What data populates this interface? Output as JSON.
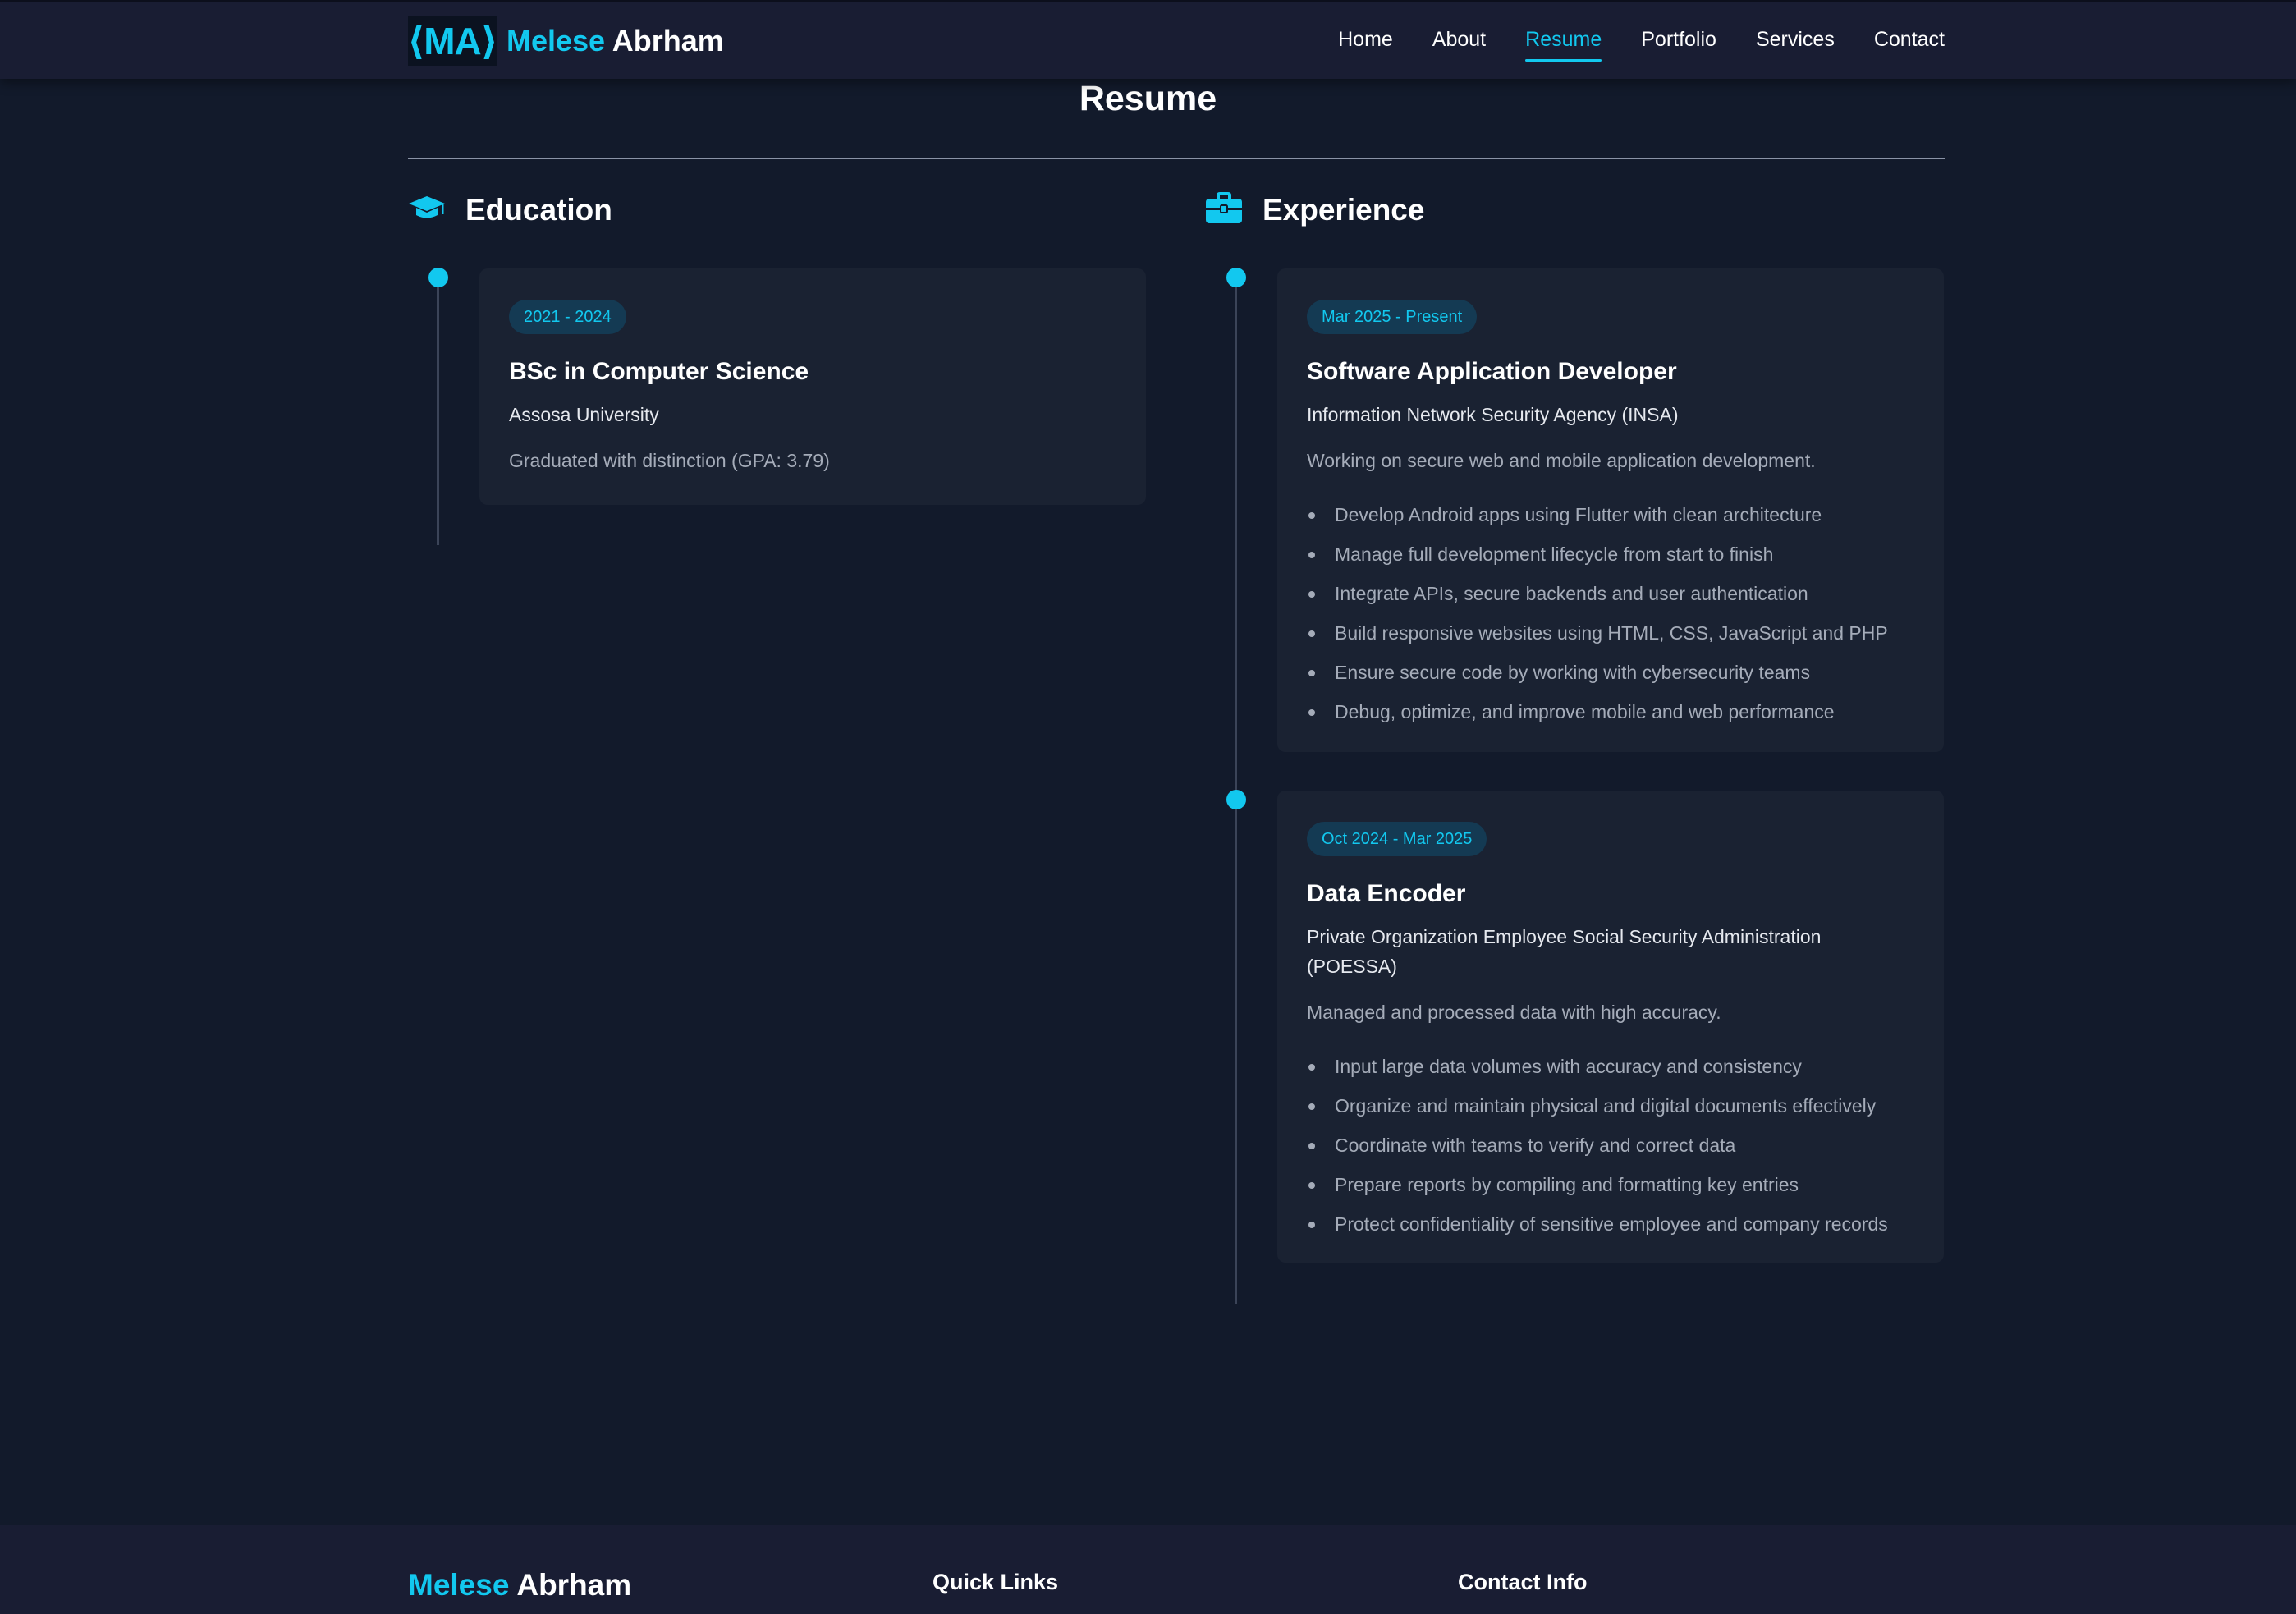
{
  "header": {
    "logo_badge": "⟨MA⟩",
    "brand_first": "Melese",
    "brand_last": "Abrham",
    "nav": [
      {
        "label": "Home",
        "active": false
      },
      {
        "label": "About",
        "active": false
      },
      {
        "label": "Resume",
        "active": true
      },
      {
        "label": "Portfolio",
        "active": false
      },
      {
        "label": "Services",
        "active": false
      },
      {
        "label": "Contact",
        "active": false
      }
    ]
  },
  "resume": {
    "title": "Resume",
    "education": {
      "heading": "Education",
      "icon": "graduation-cap-icon",
      "items": [
        {
          "date": "2021 - 2024",
          "title": "BSc in Computer Science",
          "organization": "Assosa University",
          "description": "Graduated with distinction (GPA: 3.79)"
        }
      ]
    },
    "experience": {
      "heading": "Experience",
      "icon": "briefcase-icon",
      "items": [
        {
          "date": "Mar 2025 - Present",
          "title": "Software Application Developer",
          "organization": "Information Network Security Agency (INSA)",
          "description": "Working on secure web and mobile application development.",
          "bullets": [
            "Develop Android apps using Flutter with clean architecture",
            "Manage full development lifecycle from start to finish",
            "Integrate APIs, secure backends and user authentication",
            "Build responsive websites using HTML, CSS, JavaScript and PHP",
            "Ensure secure code by working with cybersecurity teams",
            "Debug, optimize, and improve mobile and web performance"
          ]
        },
        {
          "date": "Oct 2024 - Mar 2025",
          "title": "Data Encoder",
          "organization": "Private Organization Employee Social Security Administration (POESSA)",
          "description": "Managed and processed data with high accuracy.",
          "bullets": [
            "Input large data volumes with accuracy and consistency",
            "Organize and maintain physical and digital documents effectively",
            "Coordinate with teams to verify and correct data",
            "Prepare reports by compiling and formatting key entries",
            "Protect confidentiality of sensitive employee and company records"
          ]
        }
      ]
    }
  },
  "footer": {
    "brand_first": "Melese",
    "brand_last": "Abrham",
    "quick_links_heading": "Quick Links",
    "contact_info_heading": "Contact Info"
  },
  "colors": {
    "accent": "#12c8ef",
    "background": "#121a2b",
    "header_bg": "#191d33",
    "card_bg": "#1a2232"
  }
}
